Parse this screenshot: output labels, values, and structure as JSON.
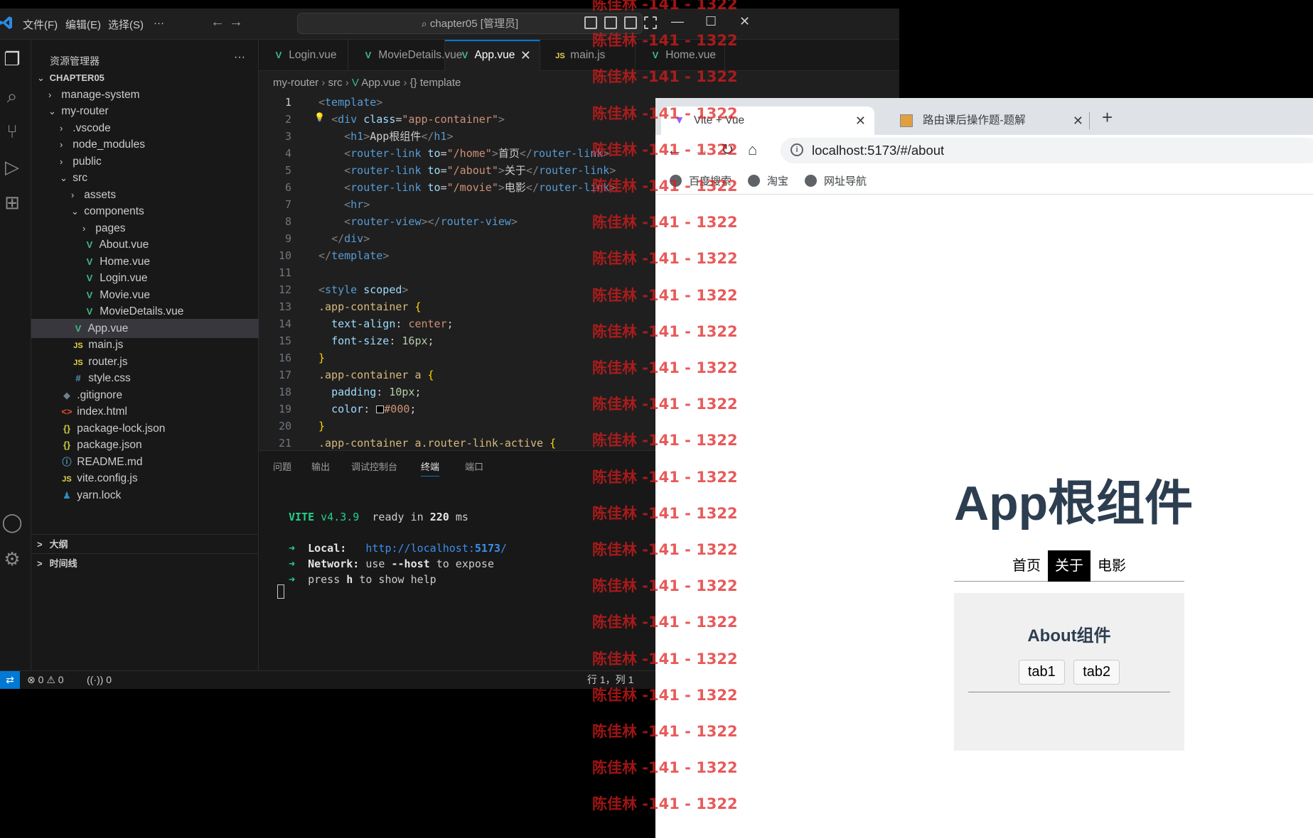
{
  "vscode": {
    "menu": [
      "文件(F)",
      "编辑(E)",
      "选择(S)",
      "···"
    ],
    "command_center": "chapter05 [管理员]",
    "explorer": {
      "title": "资源管理器",
      "more": "···",
      "tree": [
        {
          "label": "CHAPTER05",
          "kind": "root",
          "chevron": "v",
          "icon": "",
          "depth": 0
        },
        {
          "label": "manage-system",
          "kind": "folder",
          "chevron": ">",
          "icon": "",
          "depth": 1
        },
        {
          "label": "my-router",
          "kind": "folder",
          "chevron": "v",
          "icon": "",
          "depth": 1
        },
        {
          "label": ".vscode",
          "kind": "folder",
          "chevron": ">",
          "icon": "",
          "depth": 2
        },
        {
          "label": "node_modules",
          "kind": "folder",
          "chevron": ">",
          "icon": "",
          "depth": 2
        },
        {
          "label": "public",
          "kind": "folder",
          "chevron": ">",
          "icon": "",
          "depth": 2
        },
        {
          "label": "src",
          "kind": "folder",
          "chevron": "v",
          "icon": "",
          "depth": 2
        },
        {
          "label": "assets",
          "kind": "folder",
          "chevron": ">",
          "icon": "",
          "depth": 3
        },
        {
          "label": "components",
          "kind": "folder",
          "chevron": "v",
          "icon": "",
          "depth": 3
        },
        {
          "label": "pages",
          "kind": "folder",
          "chevron": ">",
          "icon": "",
          "depth": 4
        },
        {
          "label": "About.vue",
          "kind": "vue",
          "chevron": "",
          "icon": "V",
          "depth": 4
        },
        {
          "label": "Home.vue",
          "kind": "vue",
          "chevron": "",
          "icon": "V",
          "depth": 4
        },
        {
          "label": "Login.vue",
          "kind": "vue",
          "chevron": "",
          "icon": "V",
          "depth": 4
        },
        {
          "label": "Movie.vue",
          "kind": "vue",
          "chevron": "",
          "icon": "V",
          "depth": 4
        },
        {
          "label": "MovieDetails.vue",
          "kind": "vue",
          "chevron": "",
          "icon": "V",
          "depth": 4
        },
        {
          "label": "App.vue",
          "kind": "vue",
          "chevron": "",
          "icon": "V",
          "depth": 3,
          "selected": true
        },
        {
          "label": "main.js",
          "kind": "js",
          "chevron": "",
          "icon": "JS",
          "depth": 3
        },
        {
          "label": "router.js",
          "kind": "js",
          "chevron": "",
          "icon": "JS",
          "depth": 3
        },
        {
          "label": "style.css",
          "kind": "css",
          "chevron": "",
          "icon": "#",
          "depth": 3
        },
        {
          "label": ".gitignore",
          "kind": "git",
          "chevron": "",
          "icon": "◆",
          "depth": 2
        },
        {
          "label": "index.html",
          "kind": "html",
          "chevron": "",
          "icon": "<>",
          "depth": 2
        },
        {
          "label": "package-lock.json",
          "kind": "json",
          "chevron": "",
          "icon": "{}",
          "depth": 2
        },
        {
          "label": "package.json",
          "kind": "json",
          "chevron": "",
          "icon": "{}",
          "depth": 2
        },
        {
          "label": "README.md",
          "kind": "info",
          "chevron": "",
          "icon": "ⓘ",
          "depth": 2
        },
        {
          "label": "vite.config.js",
          "kind": "js",
          "chevron": "",
          "icon": "JS",
          "depth": 2
        },
        {
          "label": "yarn.lock",
          "kind": "yarn",
          "chevron": "",
          "icon": "♟",
          "depth": 2
        }
      ],
      "outline": "大纲",
      "timeline": "时间线"
    },
    "tabs": [
      {
        "label": "Login.vue",
        "icon": "V",
        "kind": "vue"
      },
      {
        "label": "MovieDetails.vue",
        "icon": "V",
        "kind": "vue"
      },
      {
        "label": "App.vue",
        "icon": "V",
        "kind": "vue",
        "active": true,
        "close": "✕"
      },
      {
        "label": "main.js",
        "icon": "JS",
        "kind": "js"
      },
      {
        "label": "Home.vue",
        "icon": "V",
        "kind": "vue"
      }
    ],
    "breadcrumb": [
      "my-router",
      "src",
      "App.vue",
      "template"
    ],
    "code_lines": [
      {
        "n": "1",
        "html": "<span class=\"tgb\">&lt;</span><span class=\"tg\">template</span><span class=\"tgb\">&gt;</span>"
      },
      {
        "n": "2",
        "html": "  <span class=\"tgb\">&lt;</span><span class=\"tg\">div</span> <span class=\"at\">class</span><span class=\"pl\">=</span><span class=\"st\">\"app-container\"</span><span class=\"tgb\">&gt;</span>"
      },
      {
        "n": "3",
        "html": "    <span class=\"tgb\">&lt;</span><span class=\"tg\">h1</span><span class=\"tgb\">&gt;</span><span class=\"pl\">App根组件</span><span class=\"tgb\">&lt;/</span><span class=\"tg\">h1</span><span class=\"tgb\">&gt;</span>"
      },
      {
        "n": "4",
        "html": "    <span class=\"tgb\">&lt;</span><span class=\"tg\">router-link</span> <span class=\"at\">to</span><span class=\"pl\">=</span><span class=\"st\">\"/home\"</span><span class=\"tgb\">&gt;</span><span class=\"pl\">首页</span><span class=\"tgb\">&lt;/</span><span class=\"tg\">router-link</span><span class=\"tgb\">&gt;</span>"
      },
      {
        "n": "5",
        "html": "    <span class=\"tgb\">&lt;</span><span class=\"tg\">router-link</span> <span class=\"at\">to</span><span class=\"pl\">=</span><span class=\"st\">\"/about\"</span><span class=\"tgb\">&gt;</span><span class=\"pl\">关于</span><span class=\"tgb\">&lt;/</span><span class=\"tg\">router-link</span><span class=\"tgb\">&gt;</span>"
      },
      {
        "n": "6",
        "html": "    <span class=\"tgb\">&lt;</span><span class=\"tg\">router-link</span> <span class=\"at\">to</span><span class=\"pl\">=</span><span class=\"st\">\"/movie\"</span><span class=\"tgb\">&gt;</span><span class=\"pl\">电影</span><span class=\"tgb\">&lt;/</span><span class=\"tg\">router-link</span><span class=\"tgb\">&gt;</span>"
      },
      {
        "n": "7",
        "html": "    <span class=\"tgb\">&lt;</span><span class=\"tg\">hr</span><span class=\"tgb\">&gt;</span>"
      },
      {
        "n": "8",
        "html": "    <span class=\"tgb\">&lt;</span><span class=\"tg\">router-view</span><span class=\"tgb\">&gt;&lt;/</span><span class=\"tg\">router-view</span><span class=\"tgb\">&gt;</span>"
      },
      {
        "n": "9",
        "html": "  <span class=\"tgb\">&lt;/</span><span class=\"tg\">div</span><span class=\"tgb\">&gt;</span>"
      },
      {
        "n": "10",
        "html": "<span class=\"tgb\">&lt;/</span><span class=\"tg\">template</span><span class=\"tgb\">&gt;</span>"
      },
      {
        "n": "11",
        "html": ""
      },
      {
        "n": "12",
        "html": "<span class=\"tgb\">&lt;</span><span class=\"tg\">style</span> <span class=\"at\">scoped</span><span class=\"tgb\">&gt;</span>"
      },
      {
        "n": "13",
        "html": "<span class=\"sel\">.app-container</span> <span class=\"br\">{</span>"
      },
      {
        "n": "14",
        "html": "  <span class=\"pr\">text-align</span><span class=\"pl\">: </span><span class=\"val\">center</span><span class=\"pl\">;</span>"
      },
      {
        "n": "15",
        "html": "  <span class=\"pr\">font-size</span><span class=\"pl\">: </span><span class=\"num\">16px</span><span class=\"pl\">;</span>"
      },
      {
        "n": "16",
        "html": "<span class=\"br\">}</span>"
      },
      {
        "n": "17",
        "html": "<span class=\"sel\">.app-container a</span> <span class=\"br\">{</span>"
      },
      {
        "n": "18",
        "html": "  <span class=\"pr\">padding</span><span class=\"pl\">: </span><span class=\"num\">10px</span><span class=\"pl\">;</span>"
      },
      {
        "n": "19",
        "html": "  <span class=\"pr\">color</span><span class=\"pl\">: </span><span style=\"display:inline-block;width:11px;height:11px;border:1px solid #ccc;background:#000;vertical-align:-1px;\"></span><span class=\"val\">#000</span><span class=\"pl\">;</span>"
      },
      {
        "n": "20",
        "html": "<span class=\"br\">}</span>"
      },
      {
        "n": "21",
        "html": "<span class=\"sel\">.app-container a.router-link-active</span> <span class=\"br\">{</span>"
      }
    ],
    "panel_tabs": [
      "问题",
      "输出",
      "调试控制台",
      "终端",
      "端口"
    ],
    "terminal": {
      "vite": "VITE",
      "version": "v4.3.9",
      "ready": "ready in",
      "ms_value": "220",
      "ms_unit": "ms",
      "local_label": "Local:",
      "local_url_a": "http://localhost:",
      "local_port": "5173",
      "local_url_b": "/",
      "network_label": "Network:",
      "network_text_a": "use",
      "network_host": "--host",
      "network_text_b": "to expose",
      "help_a": "press",
      "help_h": "h",
      "help_b": "to show help"
    },
    "status": {
      "errors": "0",
      "warnings": "0",
      "ports": "0",
      "position": "行 1，列 1"
    }
  },
  "browser": {
    "tabs": [
      {
        "title": "Vite + Vue",
        "active": true
      },
      {
        "title": "路由课后操作题-题解",
        "active": false
      }
    ],
    "new_tab": "+",
    "url": "localhost:5173/#/about",
    "bookmarks": [
      "百度搜索",
      "淘宝",
      "网址导航"
    ],
    "page": {
      "h1": "App根组件",
      "nav": [
        {
          "label": "首页",
          "active": false
        },
        {
          "label": "关于",
          "active": true
        },
        {
          "label": "电影",
          "active": false
        }
      ],
      "about_title": "About组件",
      "tab_buttons": [
        "tab1",
        "tab2"
      ]
    }
  },
  "watermark": {
    "text": "陈佳林 -141 - 1322",
    "count": 23
  }
}
